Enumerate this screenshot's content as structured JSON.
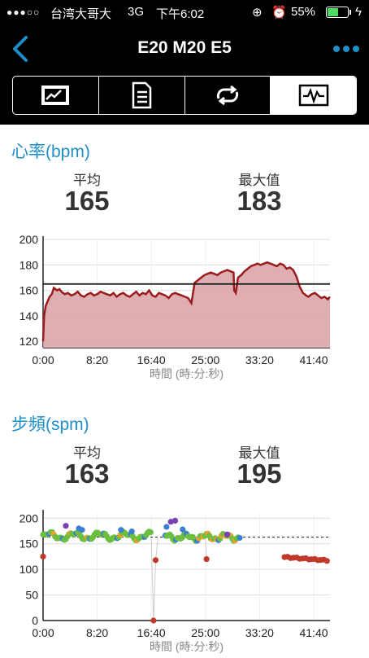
{
  "status": {
    "carrier": "台湾大哥大",
    "network": "3G",
    "time": "下午6:02",
    "battery": "55%",
    "battery_level": 0.55
  },
  "nav": {
    "title": "E20 M20 E5",
    "back_icon": "chevron-left-icon",
    "more_icon": "ellipsis-icon"
  },
  "tabs": [
    {
      "icon": "summary-chart-icon",
      "selected": false
    },
    {
      "icon": "list-document-icon",
      "selected": false
    },
    {
      "icon": "repeat-icon",
      "selected": false
    },
    {
      "icon": "waveform-icon",
      "selected": true
    }
  ],
  "heart": {
    "title": "心率(bpm)",
    "avg_label": "平均",
    "avg_value": "165",
    "max_label": "最大值",
    "max_value": "183"
  },
  "cadence": {
    "title": "步頻(spm)",
    "avg_label": "平均",
    "avg_value": "163",
    "max_label": "最大值",
    "max_value": "195"
  },
  "colors": {
    "accent": "#1e8ec6",
    "hr_line": "#9b1c1c",
    "hr_fill": "#d9a0a4",
    "green": "#6cbf3f",
    "orange": "#f0a030",
    "blue": "#3a7fd0",
    "purple": "#7a3fb0",
    "red": "#c0392b"
  },
  "chart_data": [
    {
      "type": "area",
      "name": "heart-rate",
      "xlabel": "時間 (時:分:秒)",
      "ylabel": "",
      "ylim": [
        115,
        200
      ],
      "xlim": [
        0,
        2650
      ],
      "yticks": [
        200,
        180,
        160,
        140,
        120
      ],
      "xticks": [
        "0:00",
        "8:20",
        "16:40",
        "25:00",
        "33:20",
        "41:40"
      ],
      "xtick_values": [
        0,
        500,
        1000,
        1500,
        2000,
        2500
      ],
      "average": 165,
      "x": [
        0,
        10,
        25,
        45,
        60,
        80,
        100,
        130,
        150,
        170,
        200,
        230,
        260,
        290,
        320,
        350,
        380,
        410,
        440,
        470,
        500,
        530,
        560,
        590,
        620,
        650,
        680,
        710,
        740,
        770,
        800,
        830,
        860,
        890,
        920,
        950,
        980,
        1010,
        1040,
        1070,
        1100,
        1130,
        1160,
        1190,
        1220,
        1250,
        1280,
        1310,
        1340,
        1370,
        1400,
        1430,
        1460,
        1490,
        1520,
        1550,
        1580,
        1610,
        1640,
        1670,
        1700,
        1730,
        1760,
        1765,
        1780,
        1800,
        1830,
        1860,
        1890,
        1920,
        1950,
        1980,
        2010,
        2040,
        2070,
        2100,
        2130,
        2160,
        2190,
        2220,
        2250,
        2280,
        2310,
        2340,
        2370,
        2400,
        2430,
        2450,
        2480,
        2510,
        2540,
        2570,
        2600,
        2630,
        2650
      ],
      "values": [
        120,
        140,
        148,
        152,
        155,
        157,
        162,
        160,
        161,
        159,
        157,
        158,
        156,
        157,
        159,
        156,
        155,
        157,
        158,
        156,
        157,
        159,
        158,
        157,
        156,
        158,
        155,
        157,
        158,
        156,
        155,
        157,
        159,
        156,
        158,
        157,
        160,
        156,
        155,
        158,
        157,
        156,
        154,
        157,
        158,
        157,
        156,
        155,
        154,
        150,
        166,
        168,
        170,
        172,
        173,
        174,
        173,
        172,
        174,
        175,
        176,
        175,
        174,
        160,
        158,
        170,
        172,
        175,
        177,
        179,
        180,
        181,
        180,
        181,
        182,
        181,
        180,
        179,
        181,
        180,
        177,
        178,
        176,
        171,
        163,
        158,
        156,
        155,
        157,
        158,
        156,
        154,
        155,
        153,
        155
      ]
    },
    {
      "type": "scatter",
      "name": "cadence",
      "xlabel": "時間 (時:分:秒)",
      "ylabel": "",
      "ylim": [
        0,
        210
      ],
      "xlim": [
        0,
        2650
      ],
      "yticks": [
        200,
        150,
        100,
        50,
        0
      ],
      "xticks": [
        "0:00",
        "8:20",
        "16:40",
        "25:00",
        "33:20",
        "41:40"
      ],
      "xtick_values": [
        0,
        500,
        1000,
        1500,
        2000,
        2500
      ],
      "average": 163
    }
  ]
}
